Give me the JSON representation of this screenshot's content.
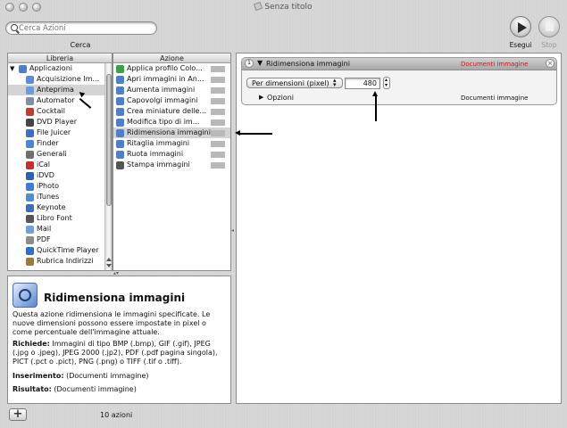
{
  "window": {
    "title": "Senza titolo"
  },
  "search": {
    "placeholder": "Cerca Azioni",
    "section_label": "Cerca"
  },
  "toolbar": {
    "run_label": "Esegui",
    "stop_label": "Stop"
  },
  "library": {
    "header": "Libreria",
    "items": [
      {
        "label": "Applicazioni",
        "icon": "applications-folder-icon",
        "color": "#4a7fd0"
      },
      {
        "label": "Acquisizione Im...",
        "icon": "image-capture-icon",
        "color": "#5b8ed8"
      },
      {
        "label": "Anteprima",
        "icon": "preview-icon",
        "color": "#6a9be0"
      },
      {
        "label": "Automator",
        "icon": "automator-robot-icon",
        "color": "#7f8fa8"
      },
      {
        "label": "Cocktail",
        "icon": "cocktail-icon",
        "color": "#c23b2b"
      },
      {
        "label": "DVD Player",
        "icon": "dvd-player-icon",
        "color": "#444444"
      },
      {
        "label": "File Juicer",
        "icon": "file-juicer-icon",
        "color": "#3c6fc4"
      },
      {
        "label": "Finder",
        "icon": "finder-icon",
        "color": "#4a86d8"
      },
      {
        "label": "Generali",
        "icon": "general-tools-icon",
        "color": "#6f6f6f"
      },
      {
        "label": "iCal",
        "icon": "ical-icon",
        "color": "#cc2b2b"
      },
      {
        "label": "iDVD",
        "icon": "idvd-icon",
        "color": "#2c5fb8"
      },
      {
        "label": "iPhoto",
        "icon": "iphoto-icon",
        "color": "#3b7dd8"
      },
      {
        "label": "iTunes",
        "icon": "itunes-icon",
        "color": "#4f8ed0"
      },
      {
        "label": "Keynote",
        "icon": "keynote-icon",
        "color": "#3a6fc0"
      },
      {
        "label": "Libro Font",
        "icon": "font-book-icon",
        "color": "#555555"
      },
      {
        "label": "Mail",
        "icon": "mail-icon",
        "color": "#6aa0e0"
      },
      {
        "label": "PDF",
        "icon": "pdf-icon",
        "color": "#8c8c8c"
      },
      {
        "label": "QuickTime Player",
        "icon": "quicktime-icon",
        "color": "#2f6fd0"
      },
      {
        "label": "Rubrica Indirizzi",
        "icon": "address-book-icon",
        "color": "#a0783c"
      }
    ],
    "selected_index": 2
  },
  "actions": {
    "header": "Azione",
    "items": [
      {
        "label": "Applica profilo Colo...",
        "icon": "colorsync-icon",
        "color": "#3aa04a"
      },
      {
        "label": "Apri immagini in An...",
        "icon": "preview-icon",
        "color": "#4f7fc8"
      },
      {
        "label": "Aumenta immagini",
        "icon": "preview-icon",
        "color": "#4f7fc8"
      },
      {
        "label": "Capovolgi immagini",
        "icon": "preview-icon",
        "color": "#4f7fc8"
      },
      {
        "label": "Crea miniature delle...",
        "icon": "preview-icon",
        "color": "#4f7fc8"
      },
      {
        "label": "Modifica tipo di im...",
        "icon": "preview-icon",
        "color": "#4f7fc8"
      },
      {
        "label": "Ridimensiona immagini",
        "icon": "preview-icon",
        "color": "#4f7fc8"
      },
      {
        "label": "Ritaglia immagini",
        "icon": "preview-icon",
        "color": "#4f7fc8"
      },
      {
        "label": "Ruota immagini",
        "icon": "preview-icon",
        "color": "#4f7fc8"
      },
      {
        "label": "Stampa immagini",
        "icon": "printer-icon",
        "color": "#555555"
      }
    ],
    "selected_index": 6
  },
  "description": {
    "title": "Ridimensiona immagini",
    "icon": "preview-icon",
    "body": "Questa azione ridimensiona le immagini specificate. Le nuove dimensioni possono essere impostate in pixel o come percentuale dell'immagine attuale.",
    "requires_label": "Richiede:",
    "requires_text": "Immagini di tipo BMP (.bmp), GIF (.gif), JPEG (.jpg o .jpeg), JPEG 2000 (.jp2), PDF (.pdf pagina singola), PICT (.pct o .pict), PNG (.png) o TIFF (.tif o .tiff).",
    "input_label": "Inserimento:",
    "input_text": "(Documenti immagine)",
    "result_label": "Risultato:",
    "result_text": "(Documenti immagine)"
  },
  "workflow": {
    "action_title": "Ridimensiona immagini",
    "input_type": "Documenti immagine",
    "input_type_color": "#cc1a1a",
    "mode_popup": "Per dimensioni (pixel)",
    "size_value": "480",
    "options_label": "Opzioni",
    "output_type": "Documenti immagine"
  },
  "footer": {
    "status": "10 azioni",
    "add_label": "+"
  }
}
